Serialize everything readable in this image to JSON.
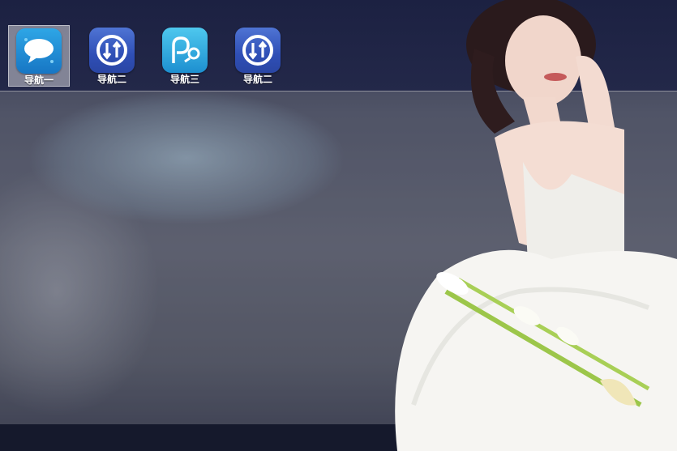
{
  "nav": {
    "items": [
      {
        "label": "导航一",
        "icon": "chat-bubble-icon",
        "active": true
      },
      {
        "label": "导航二",
        "icon": "transfer-arrows-icon",
        "active": false
      },
      {
        "label": "导航三",
        "icon": "p-search-icon",
        "active": false
      },
      {
        "label": "导航二",
        "icon": "transfer-arrows-icon",
        "active": false
      }
    ]
  },
  "colors": {
    "top_strip": "#1c2142",
    "panel_overlay": "rgba(160,160,165,0.22)",
    "icon_blue": "#3a5cc4",
    "icon_cyan": "#2ea6e6",
    "label_text": "#ffffff"
  }
}
